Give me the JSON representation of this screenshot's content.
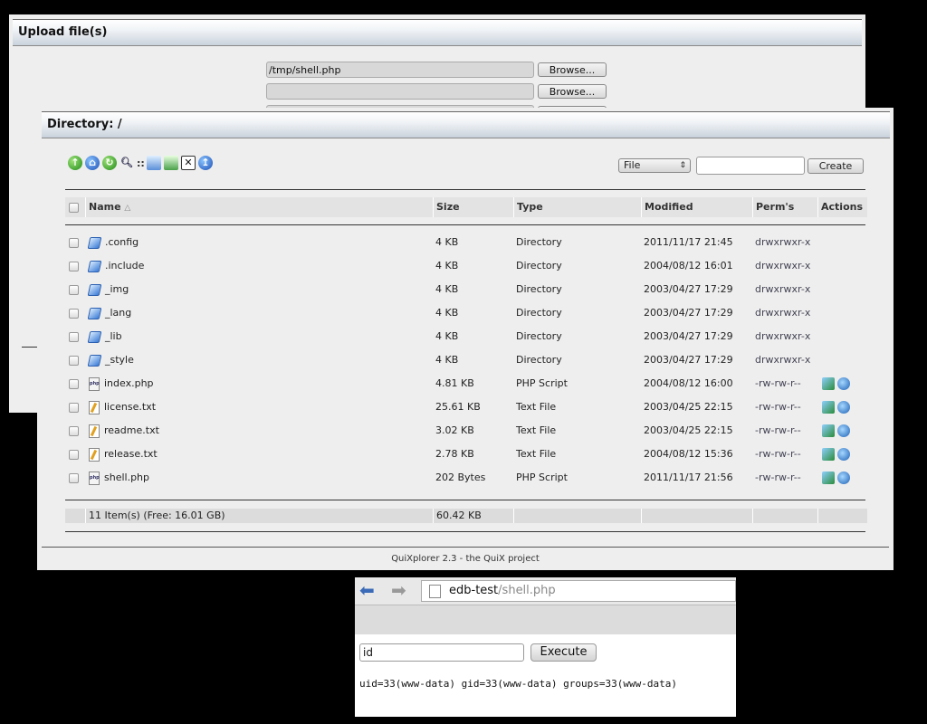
{
  "upload": {
    "title": "Upload file(s)",
    "rows": [
      {
        "value": "/tmp/shell.php",
        "button": "Browse..."
      },
      {
        "value": "",
        "button": "Browse..."
      },
      {
        "value": "",
        "button": ""
      }
    ]
  },
  "directory": {
    "title": "Directory: /",
    "toolbar_icons": [
      "up-icon",
      "home-icon",
      "reload-icon",
      "search-icon",
      "separator",
      "copy-icon",
      "move-icon",
      "delete-icon",
      "upload-icon"
    ],
    "type_select": "File",
    "new_name": "",
    "create_label": "Create",
    "columns": {
      "name": "Name",
      "sort_arrow": "△",
      "size": "Size",
      "type": "Type",
      "modified": "Modified",
      "perms": "Perm's",
      "actions": "Actions"
    },
    "rows": [
      {
        "icon": "dir",
        "name": ".config",
        "size": "4 KB",
        "type": "Directory",
        "modified": "2011/11/17 21:45",
        "perms": "drwxrwxr-x",
        "actions": false
      },
      {
        "icon": "dir",
        "name": ".include",
        "size": "4 KB",
        "type": "Directory",
        "modified": "2004/08/12 16:01",
        "perms": "drwxrwxr-x",
        "actions": false
      },
      {
        "icon": "dir",
        "name": "_img",
        "size": "4 KB",
        "type": "Directory",
        "modified": "2003/04/27 17:29",
        "perms": "drwxrwxr-x",
        "actions": false
      },
      {
        "icon": "dir",
        "name": "_lang",
        "size": "4 KB",
        "type": "Directory",
        "modified": "2003/04/27 17:29",
        "perms": "drwxrwxr-x",
        "actions": false
      },
      {
        "icon": "dir",
        "name": "_lib",
        "size": "4 KB",
        "type": "Directory",
        "modified": "2003/04/27 17:29",
        "perms": "drwxrwxr-x",
        "actions": false
      },
      {
        "icon": "dir",
        "name": "_style",
        "size": "4 KB",
        "type": "Directory",
        "modified": "2003/04/27 17:29",
        "perms": "drwxrwxr-x",
        "actions": false
      },
      {
        "icon": "php",
        "name": "index.php",
        "size": "4.81 KB",
        "type": "PHP Script",
        "modified": "2004/08/12 16:00",
        "perms": "-rw-rw-r--",
        "actions": true
      },
      {
        "icon": "txt",
        "name": "license.txt",
        "size": "25.61 KB",
        "type": "Text File",
        "modified": "2003/04/25 22:15",
        "perms": "-rw-rw-r--",
        "actions": true
      },
      {
        "icon": "txt",
        "name": "readme.txt",
        "size": "3.02 KB",
        "type": "Text File",
        "modified": "2003/04/25 22:15",
        "perms": "-rw-rw-r--",
        "actions": true
      },
      {
        "icon": "txt",
        "name": "release.txt",
        "size": "2.78 KB",
        "type": "Text File",
        "modified": "2004/08/12 15:36",
        "perms": "-rw-rw-r--",
        "actions": true
      },
      {
        "icon": "php",
        "name": "shell.php",
        "size": "202 Bytes",
        "type": "PHP Script",
        "modified": "2011/11/17 21:56",
        "perms": "-rw-rw-r--",
        "actions": true
      }
    ],
    "summary": {
      "items": "11 Item(s) (Free: 16.01 GB)",
      "total_size": "60.42 KB"
    },
    "credit": "QuiXplorer 2.3 - the QuiX project"
  },
  "browser": {
    "url_host": "edb-test",
    "url_path": "/shell.php",
    "command": "id",
    "execute_label": "Execute",
    "output": "uid=33(www-data) gid=33(www-data) groups=33(www-data)"
  }
}
